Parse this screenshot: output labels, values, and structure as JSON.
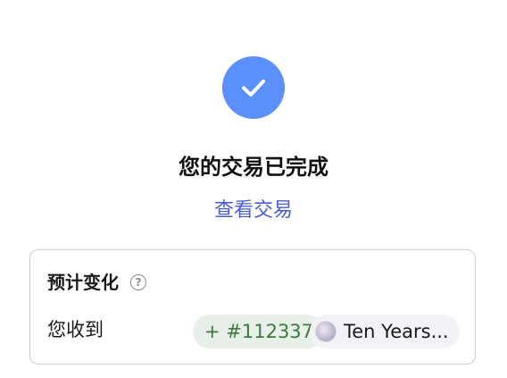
{
  "status": {
    "icon": "checkmark-icon",
    "accent_color": "#5b8ff9",
    "title": "您的交易已完成",
    "view_transaction_link": "查看交易"
  },
  "estimated_changes": {
    "title": "预计变化",
    "help_icon": "question-circle-icon",
    "received_label": "您收到",
    "token_id": "+ #112337",
    "nft_name": "Ten Years..."
  }
}
